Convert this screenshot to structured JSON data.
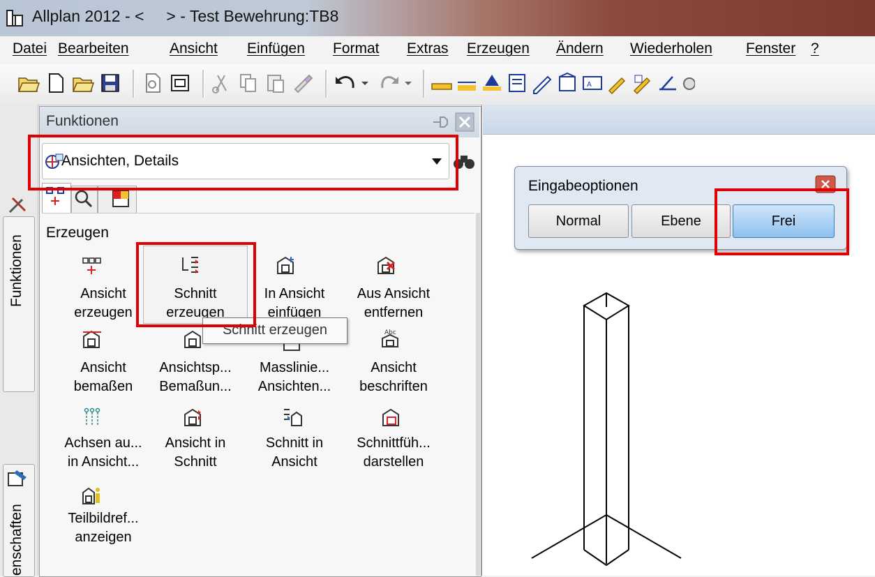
{
  "window": {
    "title": "Allplan 2012 - <     > - Test Bewehrung:TB8"
  },
  "menu": [
    {
      "label": "Datei"
    },
    {
      "label": "Bearbeiten"
    },
    {
      "label": "Ansicht"
    },
    {
      "label": "Einfügen"
    },
    {
      "label": "Format"
    },
    {
      "label": "Extras"
    },
    {
      "label": "Erzeugen"
    },
    {
      "label": "Ändern"
    },
    {
      "label": "Wiederholen"
    },
    {
      "label": "Fenster"
    },
    {
      "label": "?"
    }
  ],
  "side_tabs": {
    "funktionen": "Funktionen",
    "eigenschaften": "enschaften"
  },
  "panel": {
    "title": "Funktionen",
    "dropdown_value": "Ansichten, Details",
    "section_title": "Erzeugen",
    "items": [
      {
        "line1": "Ansicht",
        "line2": "erzeugen"
      },
      {
        "line1": "Schnitt",
        "line2": "erzeugen"
      },
      {
        "line1": "In Ansicht",
        "line2": "einfügen"
      },
      {
        "line1": "Aus Ansicht",
        "line2": "entfernen"
      },
      {
        "line1": "Ansicht",
        "line2": "bemaßen"
      },
      {
        "line1": "Ansichtsp...",
        "line2": "Bemaßun..."
      },
      {
        "line1": "Masslinie...",
        "line2": "Ansichten..."
      },
      {
        "line1": "Ansicht",
        "line2": "beschriften"
      },
      {
        "line1": "Achsen au...",
        "line2": "in Ansicht..."
      },
      {
        "line1": "Ansicht in",
        "line2": "Schnitt"
      },
      {
        "line1": "Schnitt in",
        "line2": "Ansicht"
      },
      {
        "line1": "Schnittfüh...",
        "line2": "darstellen"
      },
      {
        "line1": "Teilbildref...",
        "line2": "anzeigen"
      }
    ],
    "tooltip": "Schnitt erzeugen"
  },
  "dialog": {
    "title": "Eingabeoptionen",
    "buttons": [
      {
        "label": "Normal"
      },
      {
        "label": "Ebene"
      },
      {
        "label": "Frei"
      }
    ],
    "selected": "Frei"
  },
  "colors": {
    "highlight": "#e00000",
    "selected_button": "#7fb3e6"
  }
}
